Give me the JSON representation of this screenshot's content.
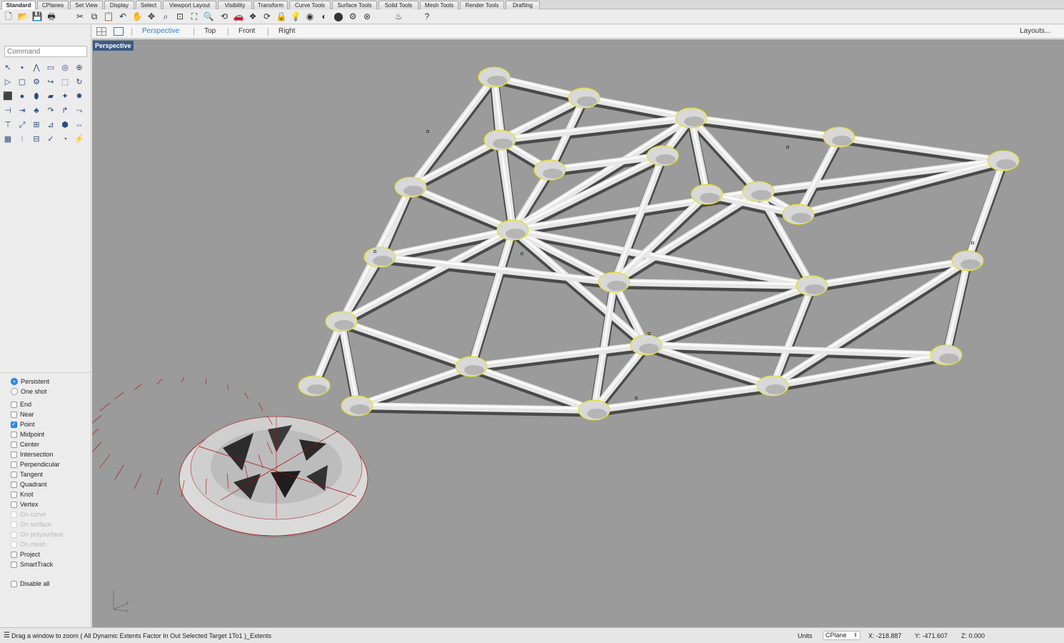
{
  "tabs": [
    "Standard",
    "CPlanes",
    "Set View",
    "Display",
    "Select",
    "Viewport Layout",
    "Visibility",
    "Transform",
    "Curve Tools",
    "Surface Tools",
    "Solid Tools",
    "Mesh Tools",
    "Render Tools",
    "Drafting"
  ],
  "active_tab": "Standard",
  "command_placeholder": "Command",
  "viewport_tabs": {
    "perspective": "Perspective",
    "top": "Top",
    "front": "Front",
    "right": "Right",
    "layouts": "Layouts..."
  },
  "viewport_label": "Perspective",
  "osnap": {
    "persistent": "Persistent",
    "one_shot": "One shot",
    "items": [
      {
        "label": "End",
        "checked": false,
        "enabled": true
      },
      {
        "label": "Near",
        "checked": false,
        "enabled": true
      },
      {
        "label": "Point",
        "checked": true,
        "enabled": true
      },
      {
        "label": "Midpoint",
        "checked": false,
        "enabled": true
      },
      {
        "label": "Center",
        "checked": false,
        "enabled": true
      },
      {
        "label": "Intersection",
        "checked": false,
        "enabled": true
      },
      {
        "label": "Perpendicular",
        "checked": false,
        "enabled": true
      },
      {
        "label": "Tangent",
        "checked": false,
        "enabled": true
      },
      {
        "label": "Quadrant",
        "checked": false,
        "enabled": true
      },
      {
        "label": "Knot",
        "checked": false,
        "enabled": true
      },
      {
        "label": "Vertex",
        "checked": false,
        "enabled": true
      },
      {
        "label": "On curve",
        "checked": false,
        "enabled": false
      },
      {
        "label": "On surface",
        "checked": false,
        "enabled": false
      },
      {
        "label": "On polysurface",
        "checked": false,
        "enabled": false
      },
      {
        "label": "On mesh",
        "checked": false,
        "enabled": false
      },
      {
        "label": "Project",
        "checked": false,
        "enabled": true
      },
      {
        "label": "SmartTrack",
        "checked": false,
        "enabled": true
      }
    ],
    "disable_all": "Disable all"
  },
  "status": {
    "prompt": "Drag a window to zoom ( All Dynamic Extents Factor In Out Selected Target 1To1 )_Extents",
    "units": "Units",
    "cplane": "CPlane",
    "x": "X: -218.887",
    "y": "Y: -471.607",
    "z": "Z: 0.000"
  },
  "colors": {
    "viewport_bg": "#9b9b9b",
    "accent": "#2d7fd6",
    "tube": "#e6e6e6",
    "highlight": "#e8e000"
  }
}
